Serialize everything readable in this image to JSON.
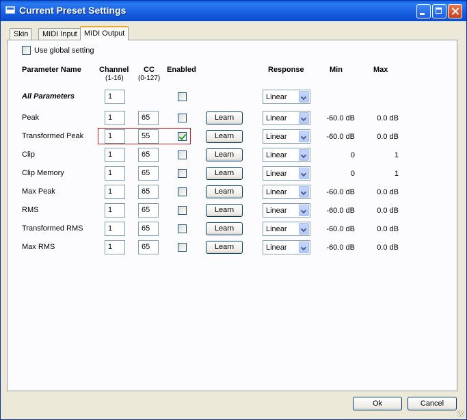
{
  "window": {
    "title": "Current Preset Settings"
  },
  "tabs": [
    {
      "label": "Skin",
      "active": false
    },
    {
      "label": "MIDI Input",
      "active": false
    },
    {
      "label": "MIDI Output",
      "active": true
    }
  ],
  "global_setting": {
    "label": "Use global setting",
    "checked": false
  },
  "headers": {
    "parameter_name": "Parameter Name",
    "channel": "Channel",
    "channel_range": "(1-16)",
    "cc": "CC",
    "cc_range": "(0-127)",
    "enabled": "Enabled",
    "response": "Response",
    "min": "Min",
    "max": "Max"
  },
  "all_parameters": {
    "name": "All Parameters",
    "channel": "1",
    "enabled": false,
    "response": "Linear"
  },
  "learn_label": "Learn",
  "rows": [
    {
      "name": "Peak",
      "channel": "1",
      "cc": "65",
      "enabled": false,
      "response": "Linear",
      "min": "-60.0 dB",
      "max": "0.0 dB"
    },
    {
      "name": "Transformed Peak",
      "channel": "1",
      "cc": "55",
      "enabled": true,
      "response": "Linear",
      "min": "-60.0 dB",
      "max": "0.0 dB"
    },
    {
      "name": "Clip",
      "channel": "1",
      "cc": "65",
      "enabled": false,
      "response": "Linear",
      "min": "0",
      "max": "1"
    },
    {
      "name": "Clip Memory",
      "channel": "1",
      "cc": "65",
      "enabled": false,
      "response": "Linear",
      "min": "0",
      "max": "1"
    },
    {
      "name": "Max Peak",
      "channel": "1",
      "cc": "65",
      "enabled": false,
      "response": "Linear",
      "min": "-60.0 dB",
      "max": "0.0 dB"
    },
    {
      "name": "RMS",
      "channel": "1",
      "cc": "65",
      "enabled": false,
      "response": "Linear",
      "min": "-60.0 dB",
      "max": "0.0 dB"
    },
    {
      "name": "Transformed RMS",
      "channel": "1",
      "cc": "65",
      "enabled": false,
      "response": "Linear",
      "min": "-60.0 dB",
      "max": "0.0 dB"
    },
    {
      "name": "Max RMS",
      "channel": "1",
      "cc": "65",
      "enabled": false,
      "response": "Linear",
      "min": "-60.0 dB",
      "max": "0.0 dB"
    }
  ],
  "buttons": {
    "ok": "Ok",
    "cancel": "Cancel"
  },
  "colors": {
    "titlebar": "#0a5fe0",
    "highlight_border": "#c82020",
    "check": "#21a121"
  }
}
